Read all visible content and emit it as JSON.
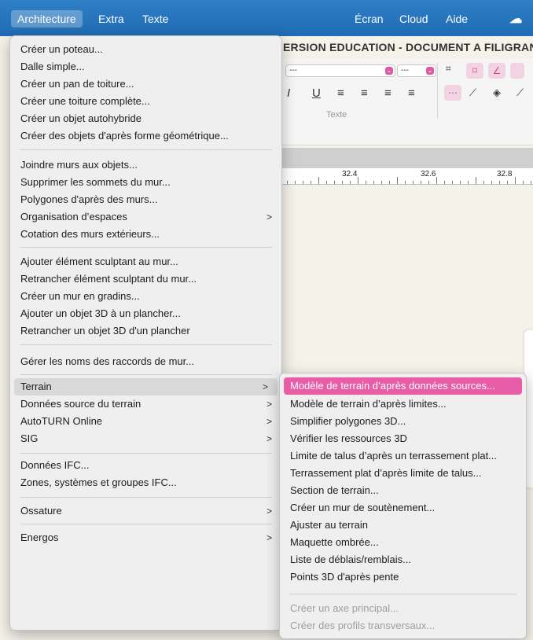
{
  "menubar": {
    "items": [
      "Architecture",
      "Extra",
      "Texte",
      "Écran",
      "Cloud",
      "Aide"
    ],
    "active": "Architecture"
  },
  "document": {
    "title": "ERSION EDUCATION - DOCUMENT A FILIGRANE",
    "toolbar": {
      "select1_value": "---",
      "select2_value": "---",
      "group_label": "Texte"
    },
    "ruler": {
      "labels": [
        "32.4",
        "32.6",
        "32.8"
      ]
    }
  },
  "main_menu": {
    "items": [
      {
        "label": "Créer un poteau..."
      },
      {
        "label": "Dalle simple..."
      },
      {
        "label": "Créer un pan de toiture..."
      },
      {
        "label": "Créer une toiture complète..."
      },
      {
        "label": "Créer un objet autohybride"
      },
      {
        "label": "Créer des objets d'après forme géométrique..."
      },
      {
        "label": "Joindre murs aux objets..."
      },
      {
        "label": "Supprimer les sommets du mur..."
      },
      {
        "label": "Polygones d'après des murs..."
      },
      {
        "label": "Organisation d’espaces",
        "submenu": true
      },
      {
        "label": "Cotation des murs extérieurs..."
      },
      {
        "label": "Ajouter élément sculptant au mur..."
      },
      {
        "label": "Retrancher élément sculptant du mur..."
      },
      {
        "label": "Créer un mur en gradins..."
      },
      {
        "label": "Ajouter un objet 3D à un plancher..."
      },
      {
        "label": "Retrancher un objet 3D d'un plancher"
      },
      {
        "label": "Gérer les noms des raccords de mur..."
      },
      {
        "label": "Terrain",
        "submenu": true,
        "highlighted": true
      },
      {
        "label": "Données source du terrain",
        "submenu": true
      },
      {
        "label": "AutoTURN Online",
        "submenu": true
      },
      {
        "label": "SIG",
        "submenu": true
      },
      {
        "label": "Données IFC..."
      },
      {
        "label": "Zones, systèmes et groupes IFC..."
      },
      {
        "label": "Ossature",
        "submenu": true
      },
      {
        "label": "Energos",
        "submenu": true
      }
    ]
  },
  "terrain_submenu": {
    "items": [
      {
        "label": "Modèle de terrain d’après données sources...",
        "selected": true
      },
      {
        "label": "Modèle de terrain d’après limites..."
      },
      {
        "label": "Simplifier polygones 3D..."
      },
      {
        "label": "Vérifier les ressources 3D"
      },
      {
        "label": "Limite de talus d’après un terrassement plat..."
      },
      {
        "label": "Terrassement plat d’après limite de talus..."
      },
      {
        "label": "Section de terrain..."
      },
      {
        "label": "Créer un mur de soutènement..."
      },
      {
        "label": "Ajuster au terrain"
      },
      {
        "label": "Maquette ombrée..."
      },
      {
        "label": "Liste de déblais/remblais..."
      },
      {
        "label": "Points 3D d'après pente"
      },
      {
        "label": "Créer un axe principal...",
        "disabled": true
      },
      {
        "label": "Créer des profils transversaux...",
        "disabled": true
      }
    ]
  },
  "colors": {
    "menubar": "#1f6bb3",
    "accent_pink": "#e95ca7",
    "menu_bg": "#efefef",
    "canvas_bg": "#f4f2e9"
  }
}
